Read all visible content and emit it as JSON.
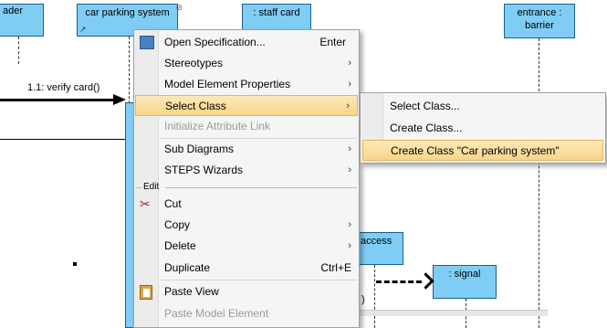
{
  "diagram": {
    "lifelines": [
      {
        "label": "ader"
      },
      {
        "label": "car parking system"
      },
      {
        "label": ": staff card"
      },
      {
        "label": "entrance : barrier",
        "line1": "entrance :",
        "line2": "barrier"
      },
      {
        "label": "access"
      },
      {
        "label": ": signal"
      }
    ],
    "messages": [
      {
        "label": "1.1: verify card()"
      },
      {
        "label": ")"
      }
    ]
  },
  "context_menu": {
    "items": [
      {
        "label": "Open Specification...",
        "shortcut": "Enter",
        "icon": "specification-icon"
      },
      {
        "label": "Stereotypes",
        "submenu": true
      },
      {
        "label": "Model Element Properties",
        "submenu": true
      },
      {
        "label": "Select Class",
        "submenu": true,
        "highlighted": true
      },
      {
        "label": "Initialize Attribute Link",
        "disabled": true
      },
      {
        "label": "Sub Diagrams",
        "submenu": true
      },
      {
        "label": "STEPS Wizards",
        "submenu": true
      },
      {
        "section": "Edit"
      },
      {
        "label": "Cut",
        "icon": "scissors-icon"
      },
      {
        "label": "Copy",
        "submenu": true
      },
      {
        "label": "Delete",
        "submenu": true
      },
      {
        "label": "Duplicate",
        "shortcut": "Ctrl+E"
      },
      {
        "label": "Paste View",
        "icon": "clipboard-icon"
      },
      {
        "label": "Paste Model Element",
        "disabled": true
      }
    ],
    "submenu_arrow": "›"
  },
  "submenu": {
    "items": [
      {
        "label": "Select Class..."
      },
      {
        "label": "Create Class..."
      },
      {
        "label": "Create Class \"Car parking system\"",
        "highlighted": true
      }
    ]
  },
  "colors": {
    "lifeline_fill": "#7fcdf5",
    "highlight": "#f8d58a"
  }
}
